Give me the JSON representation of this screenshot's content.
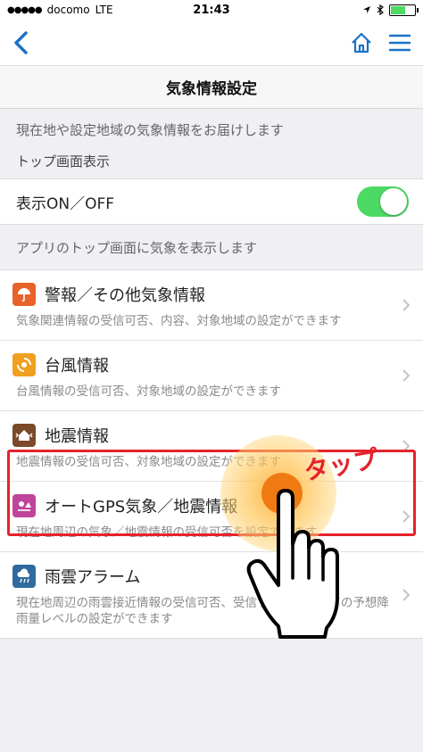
{
  "status_bar": {
    "carrier": "docomo",
    "network": "LTE",
    "time": "21:43"
  },
  "nav": {
    "back_icon": "chevron-left-icon",
    "home_icon": "home-icon",
    "menu_icon": "hamburger-menu-icon",
    "accent": "#1a73c9"
  },
  "page_title": "気象情報設定",
  "intro_text": "現在地や設定地域の気象情報をお届けします",
  "section_header": "トップ画面表示",
  "toggle": {
    "label": "表示ON／OFF",
    "state": "on",
    "color": "#4cd964"
  },
  "toggle_note": "アプリのトップ画面に気象を表示します",
  "menu": [
    {
      "title": "警報／その他気象情報",
      "desc": "気象関連情報の受信可否、内容、対象地域の設定ができます",
      "icon": "warning-umbrella-icon",
      "color": "#e8622a"
    },
    {
      "title": "台風情報",
      "desc": "台風情報の受信可否、対象地域の設定ができます",
      "icon": "typhoon-icon",
      "color": "#f0a020"
    },
    {
      "title": "地震情報",
      "desc": "地震情報の受信可否、対象地域の設定ができます",
      "icon": "earthquake-house-icon",
      "color": "#7a4a2a"
    },
    {
      "title": "オートGPS気象／地震情報",
      "desc": "現在地周辺の気象／地震情報の受信可否を設定できます",
      "icon": "gps-weather-icon",
      "color": "#c0449a"
    },
    {
      "title": "雨雲アラーム",
      "desc": "現在地周辺の雨雲接近情報の受信可否、受信するにあたっての予想降雨量レベルの設定ができます",
      "icon": "rain-cloud-icon",
      "color": "#2f6b9e"
    }
  ],
  "annotation": {
    "label": "タップ",
    "color": "#e5232b"
  }
}
